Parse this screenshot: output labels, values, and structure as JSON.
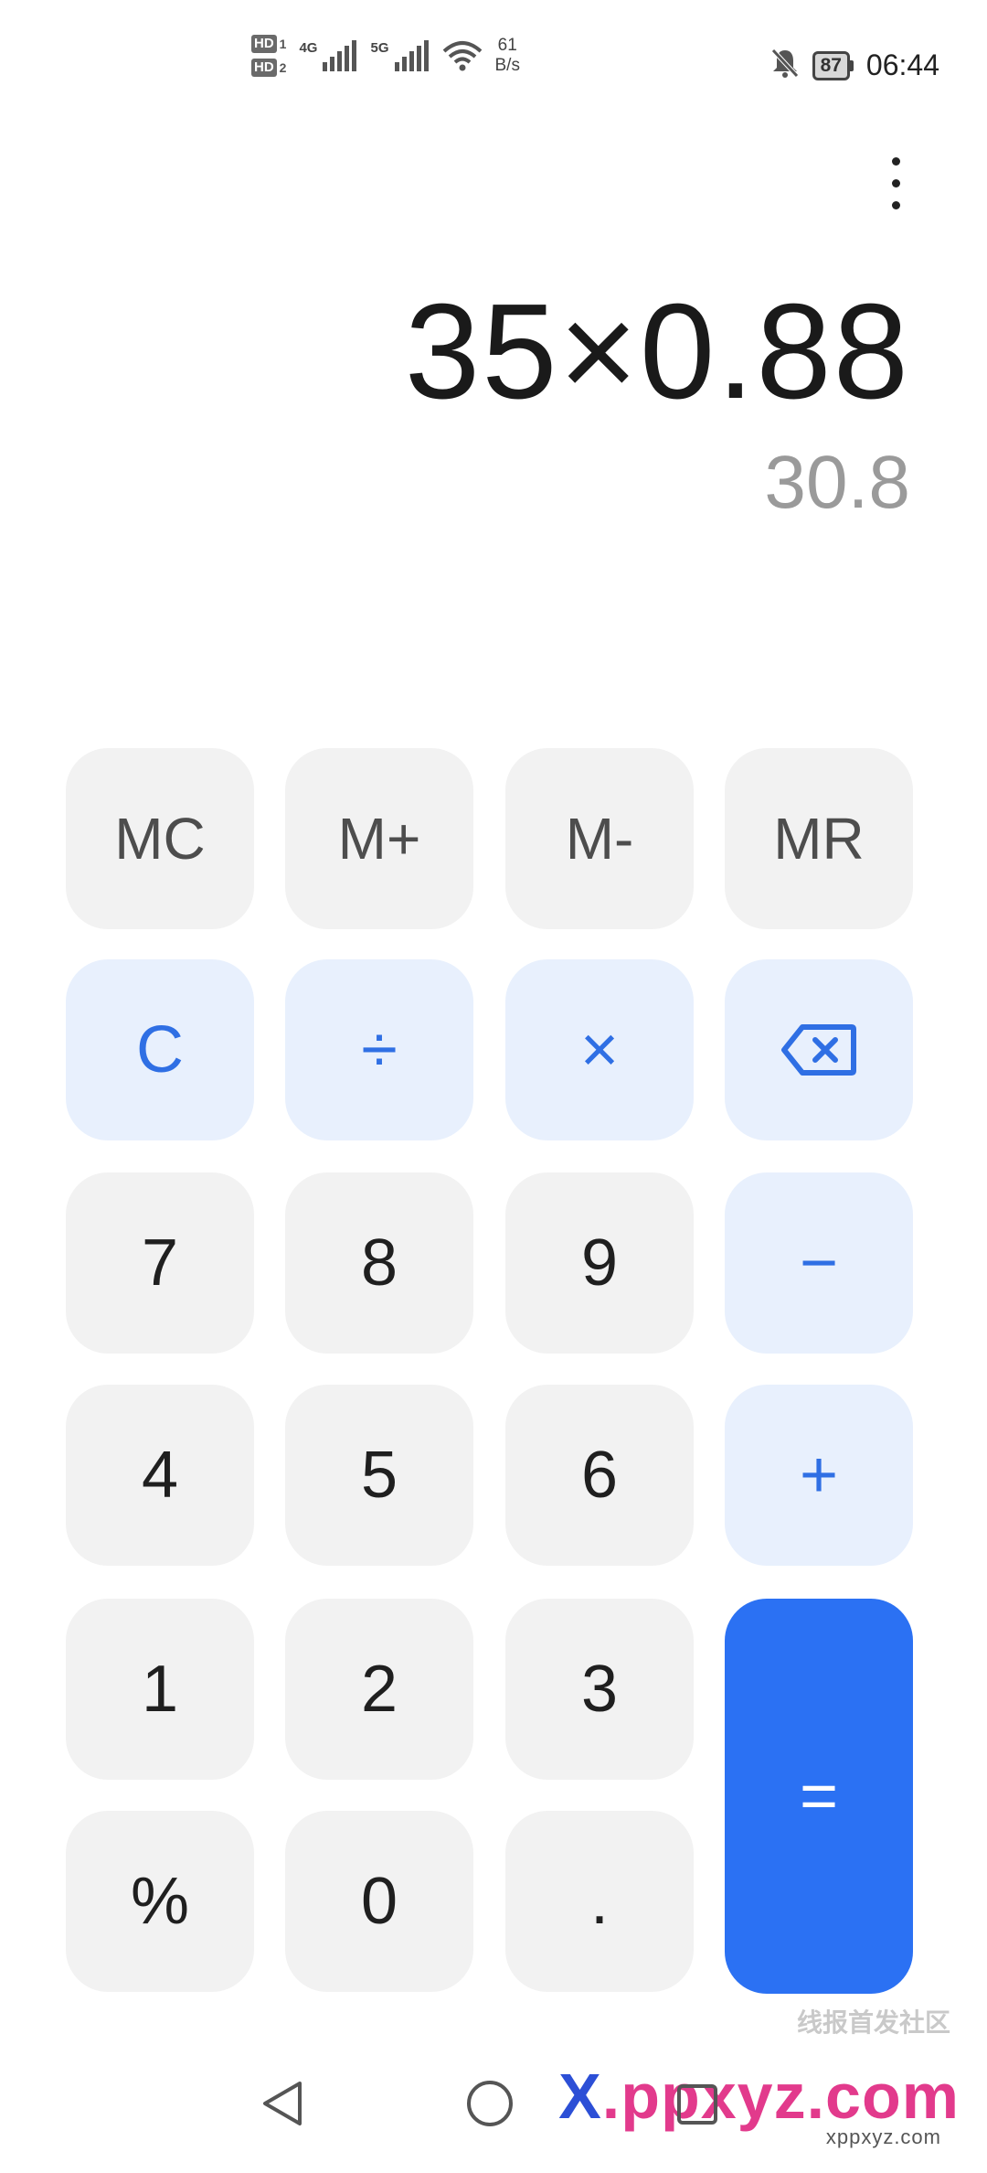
{
  "status_bar": {
    "sim1_badge": "HD",
    "sim1_index": "1",
    "sim2_badge": "HD",
    "sim2_index": "2",
    "network1": "4G",
    "network2": "5G",
    "speed_value": "61",
    "speed_unit": "B/s",
    "battery_level": "87",
    "time": "06:44",
    "icons": [
      "signal-icon",
      "wifi-icon",
      "bell-off-icon",
      "battery-icon"
    ]
  },
  "display": {
    "expression": "35×0.88",
    "result": "30.8"
  },
  "keypad": {
    "memory": [
      "MC",
      "M+",
      "M-",
      "MR"
    ],
    "clear": "C",
    "divide": "÷",
    "multiply": "×",
    "backspace_icon": "backspace-icon",
    "digits": {
      "seven": "7",
      "eight": "8",
      "nine": "9",
      "four": "4",
      "five": "5",
      "six": "6",
      "one": "1",
      "two": "2",
      "three": "3",
      "zero": "0"
    },
    "minus": "−",
    "plus": "+",
    "percent": "%",
    "decimal": ".",
    "equals": "="
  },
  "colors": {
    "operator_text": "#2f6fe4",
    "operator_bg": "#e8f0fd",
    "equals_bg": "#2b71f3",
    "key_bg": "#f2f2f2",
    "result_text": "#9a9a9a"
  },
  "watermark": {
    "caption": "线报首发社区",
    "logo_x": "X",
    "logo_rest": ".ppxyz.com",
    "url": "xppxyz.com"
  },
  "nav_bar": {
    "icons": [
      "back-icon",
      "home-icon",
      "recents-icon"
    ]
  }
}
